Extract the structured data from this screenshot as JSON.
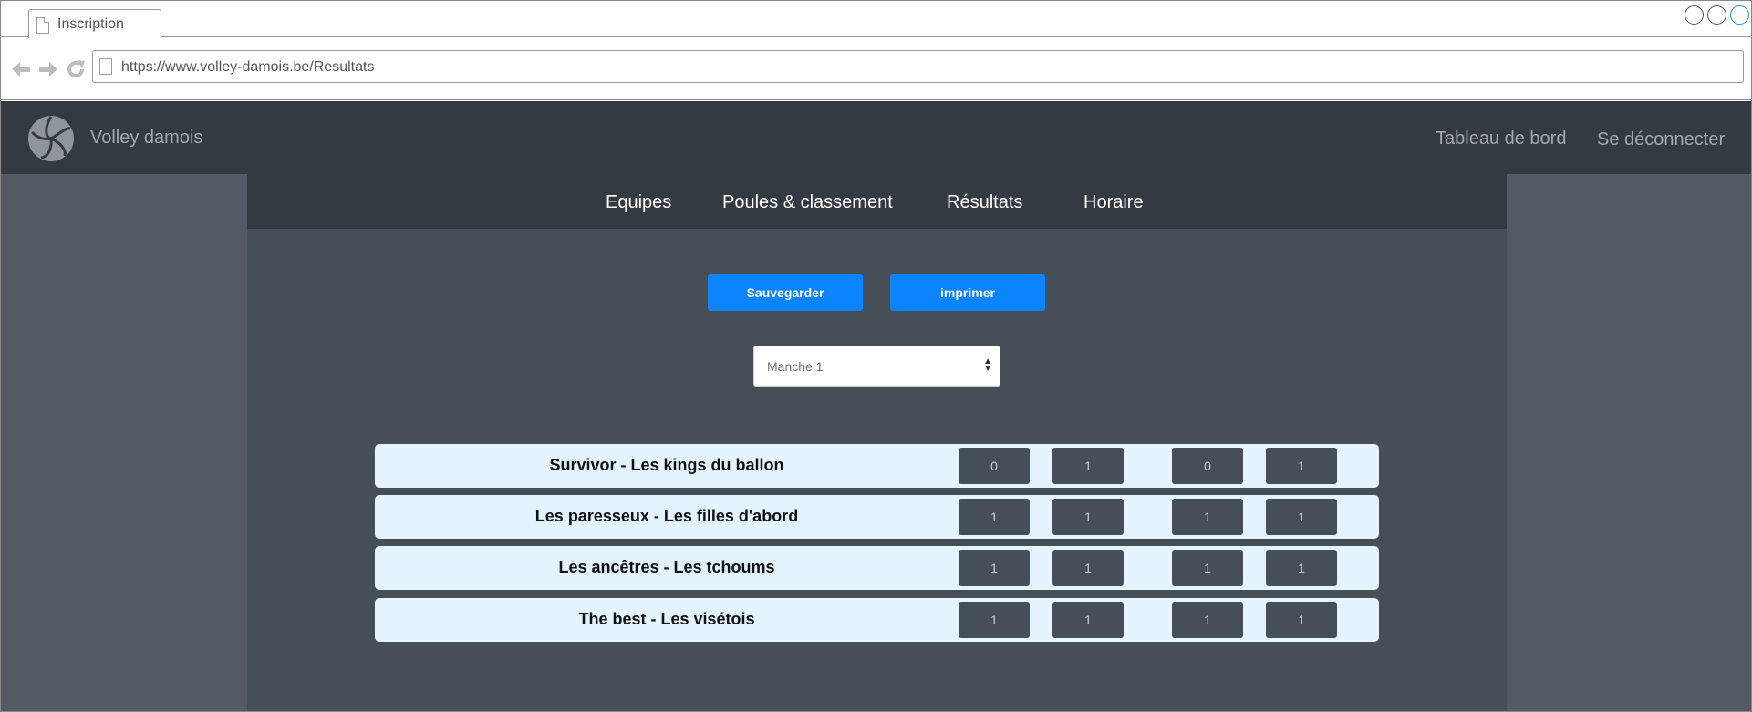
{
  "browser": {
    "tab_title": "Inscription",
    "url": "https://www.volley-damois.be/Resultats"
  },
  "header": {
    "brand": "Volley damois",
    "links": [
      "Tableau de bord",
      "Se déconnecter"
    ]
  },
  "nav": {
    "items": [
      "Equipes",
      "Poules & classement",
      "Résultats",
      "Horaire"
    ]
  },
  "actions": {
    "save_label": "Sauvegarder",
    "print_label": "imprimer"
  },
  "round_select": {
    "value": "Manche 1"
  },
  "matches": [
    {
      "label": "Survivor  -  Les kings du ballon",
      "scores": [
        "0",
        "1",
        "0",
        "1"
      ]
    },
    {
      "label": "Les paresseux  -  Les filles d'abord",
      "scores": [
        "1",
        "1",
        "1",
        "1"
      ]
    },
    {
      "label": "Les ancêtres  -  Les tchoums",
      "scores": [
        "1",
        "1",
        "1",
        "1"
      ]
    },
    {
      "label": "The best  -  Les visétois",
      "scores": [
        "1",
        "1",
        "1",
        "1"
      ]
    }
  ],
  "colors": {
    "header_bg": "#343a41",
    "content_bg": "#464e57",
    "side_bg": "#535a63",
    "accent_button": "#0d84ff",
    "row_bg": "#e4f4fe"
  }
}
